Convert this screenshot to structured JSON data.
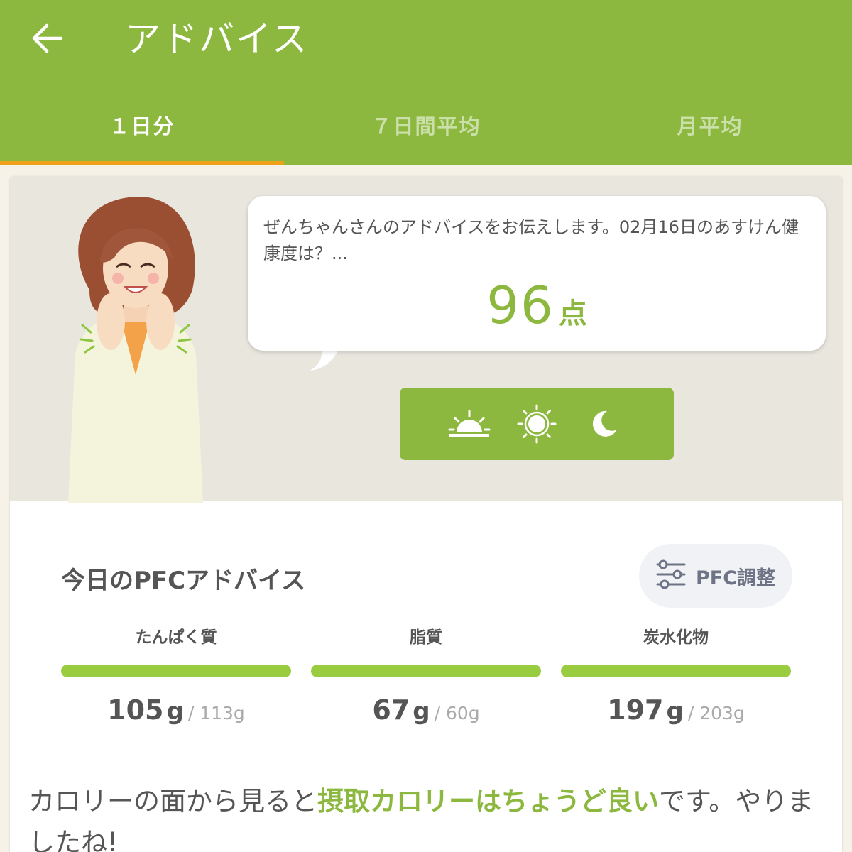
{
  "app_bar": {
    "title": "アドバイス",
    "back_icon": "arrow-left-icon"
  },
  "tabs": [
    {
      "label": "１日分",
      "active": true
    },
    {
      "label": "７日間平均",
      "active": false
    },
    {
      "label": "月平均",
      "active": false
    }
  ],
  "advice": {
    "message": "ぜんちゃんさんのアドバイスをお伝えします。02月16日のあすけん健康度は？...",
    "score": "96",
    "score_unit": "点",
    "time_icons": [
      "sunrise-icon",
      "sun-icon",
      "moon-icon"
    ]
  },
  "pfc": {
    "title": "今日のPFCアドバイス",
    "adjust_label": "PFC調整",
    "adjust_icon": "sliders-icon",
    "items": [
      {
        "name": "たんぱく質",
        "value": "105",
        "unit": "g",
        "target": "/ 113g",
        "progress": 1.0
      },
      {
        "name": "脂質",
        "value": "67",
        "unit": "g",
        "target": "/ 60g",
        "progress": 1.0
      },
      {
        "name": "炭水化物",
        "value": "197",
        "unit": "g",
        "target": "/ 203g",
        "progress": 1.0
      }
    ]
  },
  "comment": {
    "before": "カロリーの面から見ると",
    "highlight": "摂取カロリーはちょうど良い",
    "after": "です。やりましたね!"
  },
  "colors": {
    "primary": "#8cb83f",
    "tab_indicator": "#f0a11a",
    "bar": "#99cc3f"
  }
}
